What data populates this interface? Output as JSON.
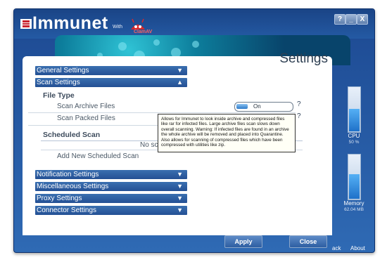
{
  "app": {
    "name": "Immunet",
    "with_label": "With",
    "partner": "ClamAV",
    "colors": {
      "window": "#2a5fa8",
      "accent": "#3a6fb0",
      "meter": "#2f7bc8"
    }
  },
  "window_controls": {
    "help": "?",
    "minimize": "_",
    "close": "X"
  },
  "page_title": "Settings",
  "sections": {
    "general": {
      "label": "General Settings",
      "arrow": "▼"
    },
    "scan": {
      "label": "Scan Settings",
      "arrow": "▲"
    },
    "notification": {
      "label": "Notification Settings",
      "arrow": "▼"
    },
    "misc": {
      "label": "Miscellaneous Settings",
      "arrow": "▼"
    },
    "proxy": {
      "label": "Proxy Settings",
      "arrow": "▼"
    },
    "connector": {
      "label": "Connector Settings",
      "arrow": "▼"
    }
  },
  "scan": {
    "file_type_label": "File Type",
    "archive_label": "Scan Archive Files",
    "archive_toggle": "On",
    "packed_label": "Scan Packed Files",
    "help_mark": "?",
    "scheduled_label": "Scheduled Scan",
    "no_schedule_text": "No sc",
    "add_schedule": "Add New Scheduled Scan"
  },
  "tooltip": {
    "text": "Allows for Immunet to look inside archive and compressed files like rar for infected files. Large archive files scan slows down overall scanning. Warning: If infected files are found in an archive the whole archive will be removed and placed into Quarantine. Also allows for scanning of compressed files which have been compressed with utilities like zip."
  },
  "meters": {
    "cpu": {
      "label": "CPU",
      "value": "50 %",
      "level": 0.5
    },
    "memory": {
      "label": "Memory",
      "value": "62.04 MB",
      "level": 0.55
    }
  },
  "buttons": {
    "apply": "Apply",
    "close": "Close"
  },
  "footer": {
    "back": "ack",
    "about": "About"
  }
}
